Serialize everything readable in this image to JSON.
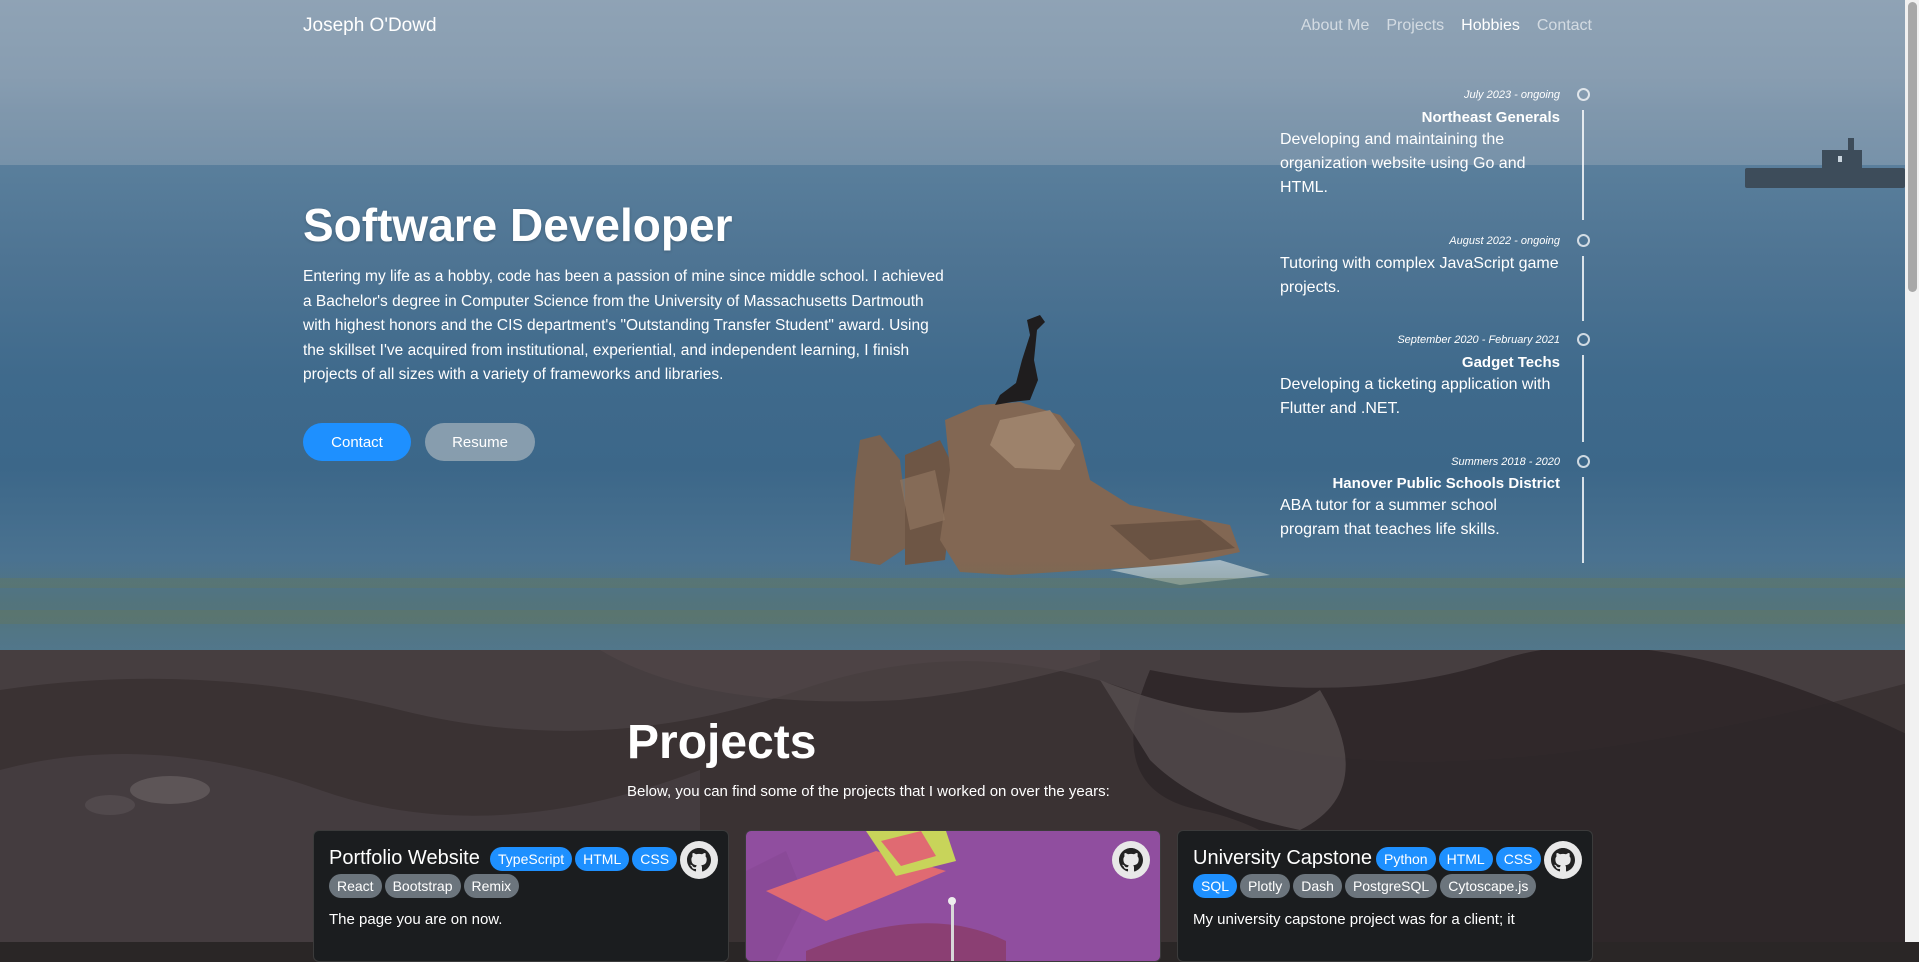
{
  "nav": {
    "brand": "Joseph O'Dowd",
    "links": [
      "About Me",
      "Projects",
      "Hobbies",
      "Contact"
    ]
  },
  "hero": {
    "title": "Software Developer",
    "text": "Entering my life as a hobby, code has been a passion of mine since middle school. I achieved a Bachelor's degree in Computer Science from the University of Massachusetts Dartmouth with highest honors and the CIS department's \"Outstanding Transfer Student\" award. Using the skillset I've acquired from institutional, experiential, and independent learning, I finish projects of all sizes with a variety of frameworks and libraries.",
    "contact_label": "Contact",
    "resume_label": "Resume"
  },
  "timeline": [
    {
      "date": "July 2023 - ongoing",
      "org": "Northeast Generals",
      "desc": "Developing and maintaining the organization website using Go and HTML."
    },
    {
      "date": "August 2022 - ongoing",
      "org": "",
      "desc": "Tutoring with complex JavaScript game projects."
    },
    {
      "date": "September 2020 - February 2021",
      "org": "Gadget Techs",
      "desc": "Developing a ticketing application with Flutter and .NET."
    },
    {
      "date": "Summers 2018 - 2020",
      "org": "Hanover Public Schools District",
      "desc": "ABA tutor for a summer school program that teaches life skills."
    }
  ],
  "projects": {
    "title": "Projects",
    "subtitle": "Below, you can find some of the projects that I worked on over the years:",
    "cards": [
      {
        "title": "Portfolio Website",
        "tags_row1": [
          "TypeScript",
          "HTML",
          "CSS"
        ],
        "tags_row2": [
          "React",
          "Bootstrap",
          "Remix"
        ],
        "desc": "The page you are on now."
      },
      {
        "title": "",
        "tags_row1": [],
        "tags_row2": [],
        "desc": ""
      },
      {
        "title": "University Capstone",
        "tags_row1": [
          "Python",
          "HTML",
          "CSS"
        ],
        "tags_row2": [
          "SQL",
          "Plotly",
          "Dash",
          "PostgreSQL",
          "Cytoscape.js"
        ],
        "desc": "My university capstone project was for a client; it"
      }
    ]
  },
  "icons": {
    "github": "github-icon",
    "timeline_dot": "circle-icon"
  },
  "colors": {
    "accent": "#1e90ff",
    "tag_grey": "#6c757d",
    "card_bg": "#1b1d1f"
  }
}
